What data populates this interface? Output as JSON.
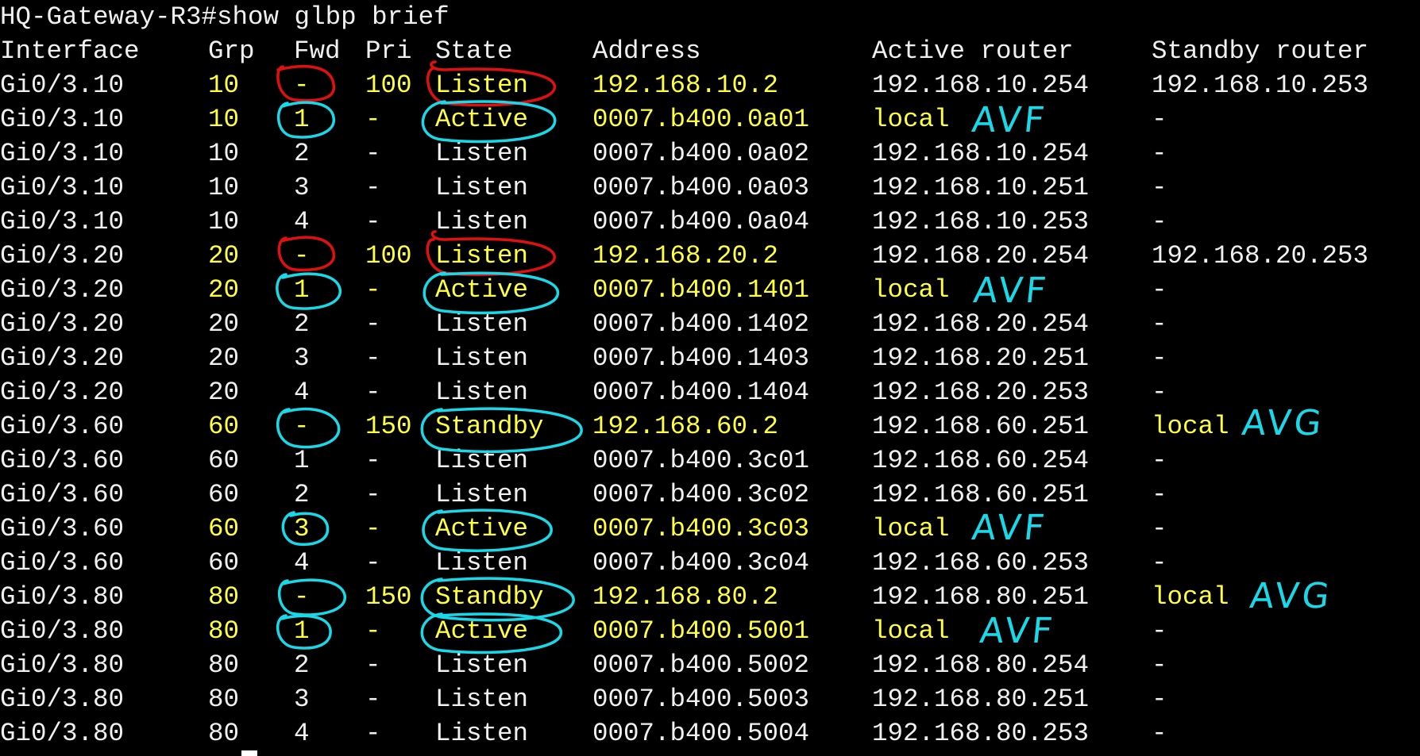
{
  "terminal": {
    "prompt": "HQ-Gateway-R3#show glbp brief",
    "headers": {
      "interface": "Interface",
      "grp": "Grp",
      "fwd": "Fwd",
      "pri": "Pri",
      "state": "State",
      "address": "Address",
      "active_router": "Active router",
      "standby_router": "Standby router"
    },
    "rows": [
      {
        "interface": "Gi0/3.10",
        "grp": "10",
        "fwd": "-",
        "pri": "100",
        "state": "Listen",
        "address": "192.168.10.2",
        "active_router": "192.168.10.254",
        "standby_router": "192.168.10.253"
      },
      {
        "interface": "Gi0/3.10",
        "grp": "10",
        "fwd": "1",
        "pri": "-",
        "state": "Active",
        "address": "0007.b400.0a01",
        "active_router": "local",
        "standby_router": "-"
      },
      {
        "interface": "Gi0/3.10",
        "grp": "10",
        "fwd": "2",
        "pri": "-",
        "state": "Listen",
        "address": "0007.b400.0a02",
        "active_router": "192.168.10.254",
        "standby_router": "-"
      },
      {
        "interface": "Gi0/3.10",
        "grp": "10",
        "fwd": "3",
        "pri": "-",
        "state": "Listen",
        "address": "0007.b400.0a03",
        "active_router": "192.168.10.251",
        "standby_router": "-"
      },
      {
        "interface": "Gi0/3.10",
        "grp": "10",
        "fwd": "4",
        "pri": "-",
        "state": "Listen",
        "address": "0007.b400.0a04",
        "active_router": "192.168.10.253",
        "standby_router": "-"
      },
      {
        "interface": "Gi0/3.20",
        "grp": "20",
        "fwd": "-",
        "pri": "100",
        "state": "Listen",
        "address": "192.168.20.2",
        "active_router": "192.168.20.254",
        "standby_router": "192.168.20.253"
      },
      {
        "interface": "Gi0/3.20",
        "grp": "20",
        "fwd": "1",
        "pri": "-",
        "state": "Active",
        "address": "0007.b400.1401",
        "active_router": "local",
        "standby_router": "-"
      },
      {
        "interface": "Gi0/3.20",
        "grp": "20",
        "fwd": "2",
        "pri": "-",
        "state": "Listen",
        "address": "0007.b400.1402",
        "active_router": "192.168.20.254",
        "standby_router": "-"
      },
      {
        "interface": "Gi0/3.20",
        "grp": "20",
        "fwd": "3",
        "pri": "-",
        "state": "Listen",
        "address": "0007.b400.1403",
        "active_router": "192.168.20.251",
        "standby_router": "-"
      },
      {
        "interface": "Gi0/3.20",
        "grp": "20",
        "fwd": "4",
        "pri": "-",
        "state": "Listen",
        "address": "0007.b400.1404",
        "active_router": "192.168.20.253",
        "standby_router": "-"
      },
      {
        "interface": "Gi0/3.60",
        "grp": "60",
        "fwd": "-",
        "pri": "150",
        "state": "Standby",
        "address": "192.168.60.2",
        "active_router": "192.168.60.251",
        "standby_router": "local"
      },
      {
        "interface": "Gi0/3.60",
        "grp": "60",
        "fwd": "1",
        "pri": "-",
        "state": "Listen",
        "address": "0007.b400.3c01",
        "active_router": "192.168.60.254",
        "standby_router": "-"
      },
      {
        "interface": "Gi0/3.60",
        "grp": "60",
        "fwd": "2",
        "pri": "-",
        "state": "Listen",
        "address": "0007.b400.3c02",
        "active_router": "192.168.60.251",
        "standby_router": "-"
      },
      {
        "interface": "Gi0/3.60",
        "grp": "60",
        "fwd": "3",
        "pri": "-",
        "state": "Active",
        "address": "0007.b400.3c03",
        "active_router": "local",
        "standby_router": "-"
      },
      {
        "interface": "Gi0/3.60",
        "grp": "60",
        "fwd": "4",
        "pri": "-",
        "state": "Listen",
        "address": "0007.b400.3c04",
        "active_router": "192.168.60.253",
        "standby_router": "-"
      },
      {
        "interface": "Gi0/3.80",
        "grp": "80",
        "fwd": "-",
        "pri": "150",
        "state": "Standby",
        "address": "192.168.80.2",
        "active_router": "192.168.80.251",
        "standby_router": "local"
      },
      {
        "interface": "Gi0/3.80",
        "grp": "80",
        "fwd": "1",
        "pri": "-",
        "state": "Active",
        "address": "0007.b400.5001",
        "active_router": "local",
        "standby_router": "-"
      },
      {
        "interface": "Gi0/3.80",
        "grp": "80",
        "fwd": "2",
        "pri": "-",
        "state": "Listen",
        "address": "0007.b400.5002",
        "active_router": "192.168.80.254",
        "standby_router": "-"
      },
      {
        "interface": "Gi0/3.80",
        "grp": "80",
        "fwd": "3",
        "pri": "-",
        "state": "Listen",
        "address": "0007.b400.5003",
        "active_router": "192.168.80.251",
        "standby_router": "-"
      },
      {
        "interface": "Gi0/3.80",
        "grp": "80",
        "fwd": "4",
        "pri": "-",
        "state": "Listen",
        "address": "0007.b400.5004",
        "active_router": "192.168.80.253",
        "standby_router": "-"
      }
    ],
    "highlighted_rows": [
      0,
      1,
      5,
      6,
      10,
      13,
      15,
      16
    ]
  },
  "annotations": {
    "avf_label": "AVF",
    "avg_label": "AVG"
  },
  "colors": {
    "background": "#000000",
    "text": "#f0f0f0",
    "highlight": "#ffff40",
    "annotation_red": "#e01010",
    "annotation_cyan": "#19d8e8"
  }
}
